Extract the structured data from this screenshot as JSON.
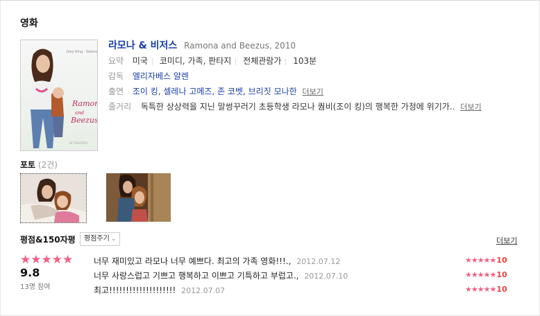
{
  "section_title": "영화",
  "movie": {
    "title": "라모나 & 비저스",
    "original": "Ramona and Beezus, 2010",
    "summary_label": "요약",
    "country": "미국",
    "genre": "코미디, 가족, 판타지",
    "rating_class": "전체관람가",
    "runtime": "103분",
    "director_label": "감독",
    "director": "엘리자베스 알렌",
    "cast_label": "출연",
    "cast": "조이 킹, 셀레나 고메즈, 존 코벳, 브리짓 모나한",
    "plot_label": "줄거리",
    "plot": "독특한 상상력을 지닌 말썽꾸러기 초등학생 라모나 퀌비(조이 킹)의 행복한 가정에 위기가..",
    "more_label": "더보기",
    "poster_title": "Ramona and Beezus"
  },
  "photos": {
    "label": "포토",
    "count": "(2건)"
  },
  "reviews": {
    "label": "평점&150자평",
    "rate_button": "평점주기",
    "more_label": "더보기",
    "average_stars": "★★★★★",
    "average_score": "9.8",
    "participants": "13명 참여",
    "items": [
      {
        "text": "너무 재미있고 라모나 너무 예쁘다. 최고의 가족 영화!!!.,",
        "date": "2012.07.12",
        "stars": "★★★★★",
        "score": "10"
      },
      {
        "text": "너무 사랑스럽고 기쁘고 행복하고 이쁘고 기특하고 부럽고.,",
        "date": "2012.07.10",
        "stars": "★★★★★",
        "score": "10"
      },
      {
        "text": "최고!!!!!!!!!!!!!!!!!!!!",
        "date": "2012.07.07",
        "stars": "★★★★★",
        "score": "10"
      }
    ]
  },
  "colors": {
    "link": "#1a3ea8",
    "star": "#f25f83",
    "score": "#e6423f"
  }
}
